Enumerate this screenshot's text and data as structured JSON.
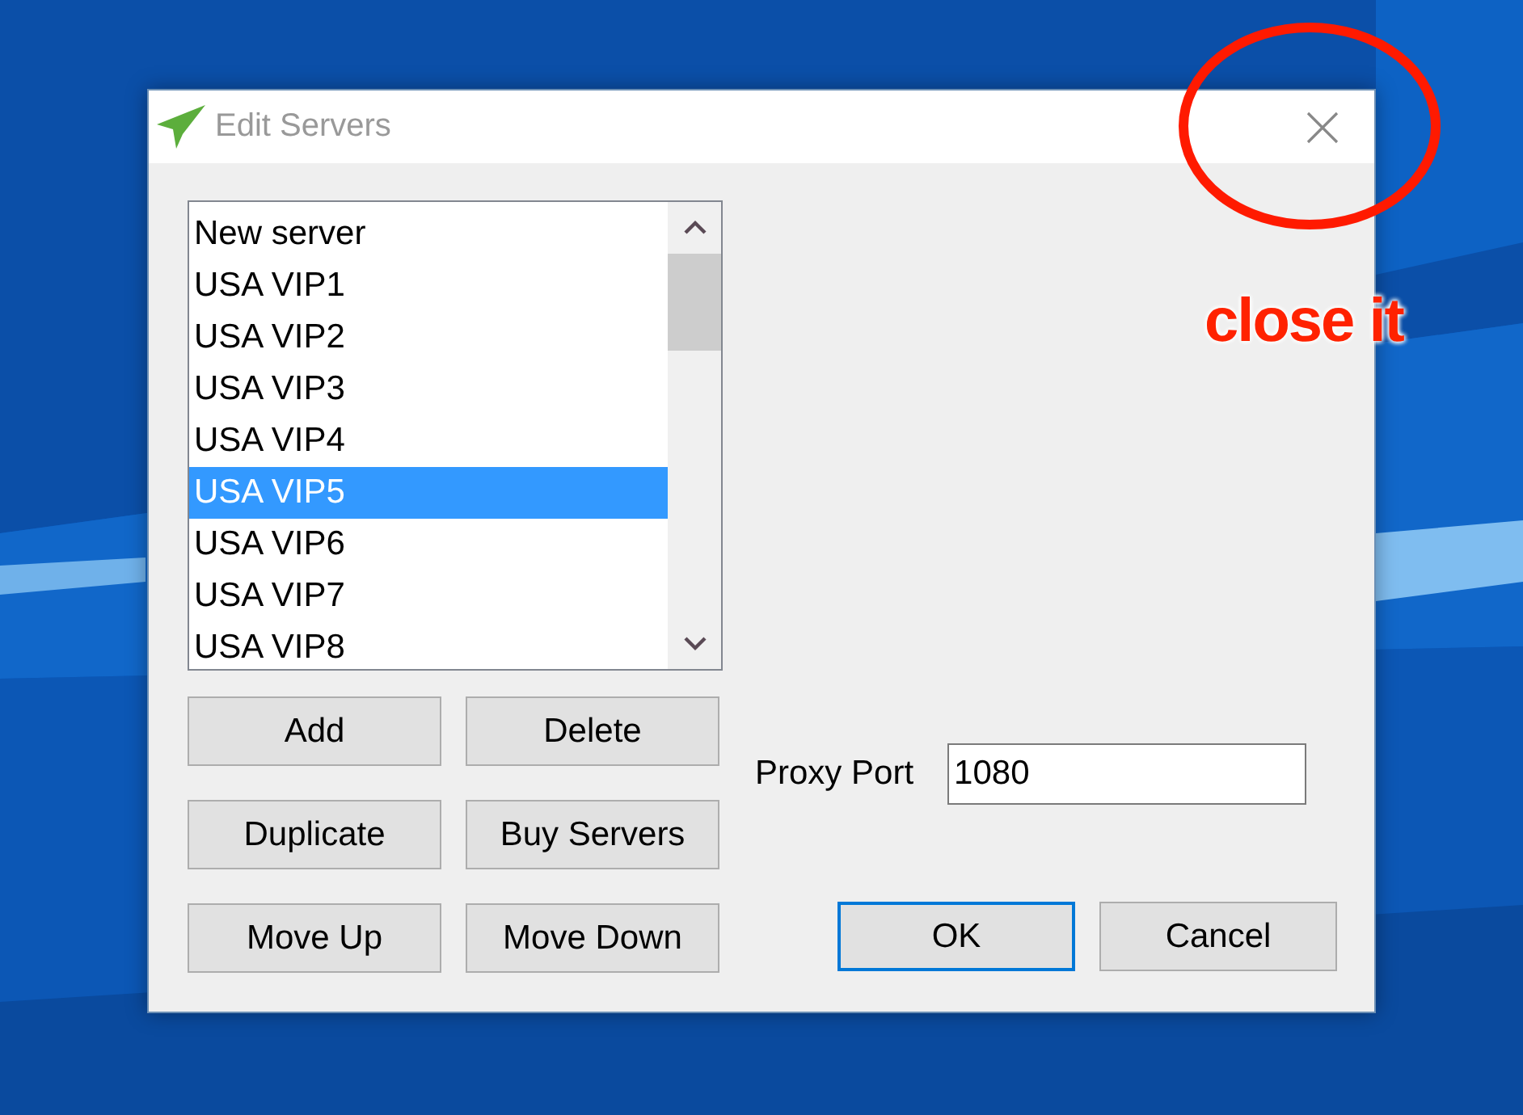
{
  "window": {
    "title": "Edit Servers"
  },
  "server_list": {
    "items": [
      {
        "label": "New server",
        "selected": false
      },
      {
        "label": "USA VIP1",
        "selected": false
      },
      {
        "label": "USA VIP2",
        "selected": false
      },
      {
        "label": "USA VIP3",
        "selected": false
      },
      {
        "label": "USA VIP4",
        "selected": false
      },
      {
        "label": "USA VIP5",
        "selected": true
      },
      {
        "label": "USA VIP6",
        "selected": false
      },
      {
        "label": "USA VIP7",
        "selected": false
      },
      {
        "label": "USA VIP8",
        "selected": false
      }
    ]
  },
  "list_buttons": [
    "Add",
    "Delete",
    "Duplicate",
    "Buy Servers",
    "Move Up",
    "Move Down"
  ],
  "proxy_port": {
    "label": "Proxy Port",
    "value": "1080"
  },
  "buttons": [
    {
      "label": "OK",
      "default": true
    },
    {
      "label": "Cancel",
      "default": false
    }
  ],
  "annotation": {
    "text": "close it"
  }
}
